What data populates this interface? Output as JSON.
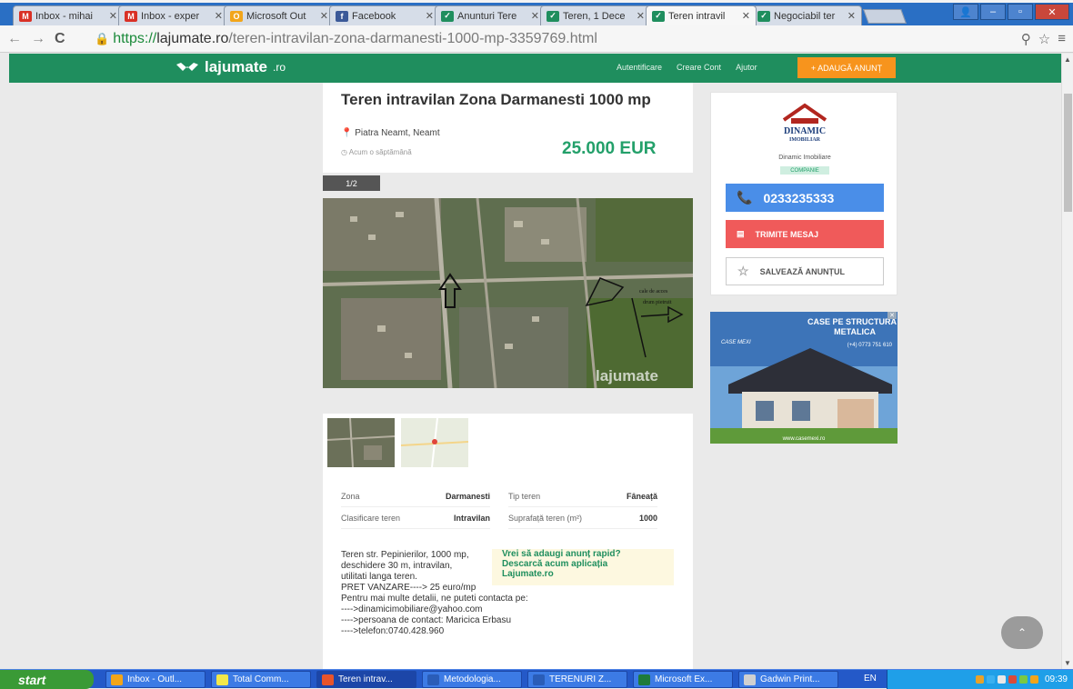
{
  "browser": {
    "tabs": [
      {
        "label": "Inbox - mihai",
        "icon": "gmail-icon",
        "color": "#d93025",
        "glyph": "M"
      },
      {
        "label": "Inbox - exper",
        "icon": "gmail-icon",
        "color": "#d93025",
        "glyph": "M"
      },
      {
        "label": "Microsoft Out",
        "icon": "outlook-icon",
        "color": "#f2a51a",
        "glyph": "O"
      },
      {
        "label": "Facebook",
        "icon": "facebook-icon",
        "color": "#3b5998",
        "glyph": "f"
      },
      {
        "label": "Anunturi Tere",
        "icon": "lajumate-icon",
        "color": "#1f8e5e",
        "glyph": "✓"
      },
      {
        "label": "Teren, 1 Dece",
        "icon": "lajumate-icon",
        "color": "#1f8e5e",
        "glyph": "✓"
      },
      {
        "label": "Teren intravil",
        "icon": "lajumate-icon",
        "color": "#1f8e5e",
        "glyph": "✓",
        "active": true
      },
      {
        "label": "Negociabil ter",
        "icon": "lajumate-icon",
        "color": "#1f8e5e",
        "glyph": "✓"
      }
    ],
    "url_scheme": "https://",
    "url_host": "lajumate.ro",
    "url_path": "/teren-intravilan-zona-darmanesti-1000-mp-3359769.html"
  },
  "site": {
    "logo": "lajumate",
    "logo_suffix": ".ro",
    "nav": [
      "Autentificare",
      "Creare Cont",
      "Ajutor"
    ],
    "post_button": "+ ADAUGĂ ANUNȚ",
    "accent": "#1f8e5e"
  },
  "listing": {
    "title": "Teren intravilan Zona Darmanesti 1000 mp",
    "location": "Piatra Neamt, Neamt",
    "posted": "Acum o săptămână",
    "price": "25.000 EUR",
    "photo_counter": "1/2",
    "watermark": "lajumate",
    "photo_labels": [
      "cale de acces",
      "drum pietruit"
    ],
    "specs": [
      [
        {
          "k": "Zona",
          "v": "Darmanesti"
        },
        {
          "k": "Tip teren",
          "v": "Fâneață"
        }
      ],
      [
        {
          "k": "Clasificare teren",
          "v": "Intravilan"
        },
        {
          "k": "Suprafață teren (m²)",
          "v": "1000"
        }
      ]
    ],
    "description": [
      "Teren str. Pepinierilor, 1000 mp,",
      "deschidere 30 m, intravilan,",
      "utilitati langa teren.",
      "",
      "PRET VANZARE----> 25 euro/mp",
      "Pentru mai multe detalii, ne puteti contacta pe:",
      "---->dinamicimobiliare@yahoo.com",
      "---->persoana de contact: Maricica Erbasu",
      "---->telefon:0740.428.960"
    ],
    "promo": [
      "Vrei să adaugi anunț rapid?",
      "Descarcă acum aplicația",
      "Lajumate.ro"
    ]
  },
  "seller": {
    "logo_text": "DINAMIC",
    "logo_sub": "IMOBILIAR",
    "name": "Dinamic Imobiliare",
    "badge": "COMPANIE",
    "phone": "0233235333",
    "message": "TRIMITE MESAJ",
    "save": "SALVEAZĂ ANUNȚUL"
  },
  "ad": {
    "headline1": "CASE PE STRUCTURĂ",
    "headline2": "METALICA",
    "phone": "(+4) 0773 751 610",
    "brand": "CASE MEXI",
    "url": "www.casemexi.ro"
  },
  "taskbar": {
    "start": "start",
    "tasks": [
      {
        "label": "Inbox - Outl...",
        "color": "#f2a51a"
      },
      {
        "label": "Total Comm...",
        "color": "#f2e84a"
      },
      {
        "label": "Teren intrav...",
        "color": "#e8542a",
        "active": true
      },
      {
        "label": "Metodologia...",
        "color": "#2a5db8"
      },
      {
        "label": "TERENURI Z...",
        "color": "#2a5db8"
      },
      {
        "label": "Microsoft Ex...",
        "color": "#1e7b3a"
      },
      {
        "label": "Gadwin Print...",
        "color": "#d0d0d0"
      }
    ],
    "language": "EN",
    "clock": "09:39"
  }
}
